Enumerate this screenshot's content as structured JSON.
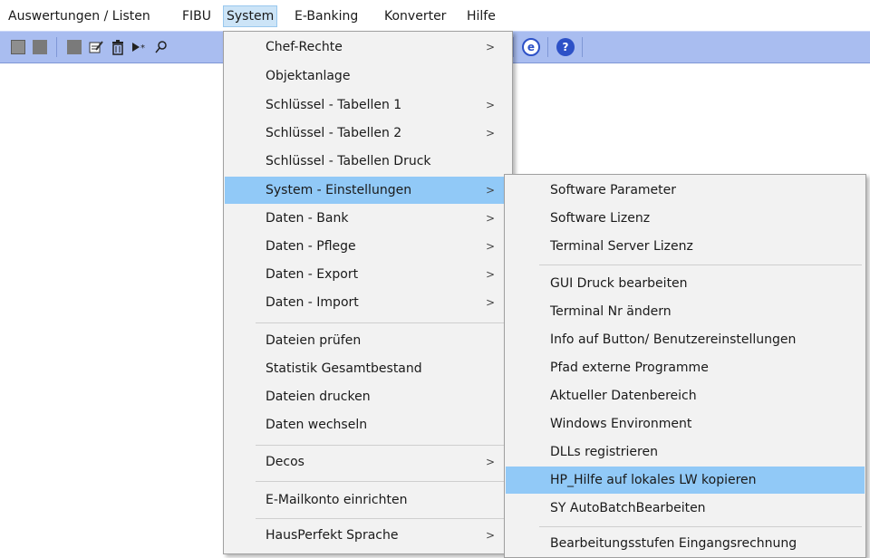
{
  "menubar": {
    "items": [
      {
        "label": "Auswertungen / Listen"
      },
      {
        "label": "FIBU"
      },
      {
        "label": "System"
      },
      {
        "label": "E-Banking"
      },
      {
        "label": "Konverter"
      },
      {
        "label": "Hilfe"
      }
    ],
    "active": "System"
  },
  "toolbar": {
    "icons": [
      "form-icon",
      "gray-square-icon",
      "gray-square-icon",
      "edit-icon",
      "trash-icon",
      "run-icon",
      "search-icon",
      "browser-icon",
      "help-icon"
    ],
    "accent": "#2d51c7",
    "background": "#a9bdf0"
  },
  "system_menu": {
    "items": [
      {
        "label": "Chef-Rechte",
        "submenu": true
      },
      {
        "label": "Objektanlage",
        "submenu": false
      },
      {
        "label": "Schlüssel - Tabellen 1",
        "submenu": true
      },
      {
        "label": "Schlüssel - Tabellen 2",
        "submenu": true
      },
      {
        "label": "Schlüssel - Tabellen Druck",
        "submenu": false
      },
      {
        "label": "System - Einstellungen",
        "submenu": true,
        "highlighted": true
      },
      {
        "label": "Daten - Bank",
        "submenu": true
      },
      {
        "label": "Daten - Pflege",
        "submenu": true
      },
      {
        "label": "Daten - Export",
        "submenu": true
      },
      {
        "label": "Daten - Import",
        "submenu": true
      },
      {
        "label": "Dateien prüfen",
        "submenu": false
      },
      {
        "label": "Statistik Gesamtbestand",
        "submenu": false
      },
      {
        "label": "Dateien drucken",
        "submenu": false
      },
      {
        "label": "Daten wechseln",
        "submenu": false
      },
      {
        "label": "Decos",
        "submenu": true
      },
      {
        "label": "E-Mailkonto einrichten",
        "submenu": false
      },
      {
        "label": "HausPerfekt Sprache",
        "submenu": true
      }
    ]
  },
  "einstellungen_submenu": {
    "items": [
      {
        "label": "Software Parameter"
      },
      {
        "label": "Software Lizenz"
      },
      {
        "label": "Terminal Server Lizenz"
      },
      {
        "label": "GUI Druck bearbeiten"
      },
      {
        "label": "Terminal Nr ändern"
      },
      {
        "label": "Info auf Button/ Benutzereinstellungen"
      },
      {
        "label": "Pfad externe Programme"
      },
      {
        "label": "Aktueller Datenbereich"
      },
      {
        "label": "Windows Environment"
      },
      {
        "label": "DLLs registrieren"
      },
      {
        "label": "HP_Hilfe auf lokales LW kopieren",
        "highlighted": true
      },
      {
        "label": "SY AutoBatchBearbeiten"
      },
      {
        "label": "Bearbeitungsstufen Eingangsrechnung"
      }
    ]
  },
  "arrow_glyph": ">",
  "highlight_color": "#91c9f7"
}
